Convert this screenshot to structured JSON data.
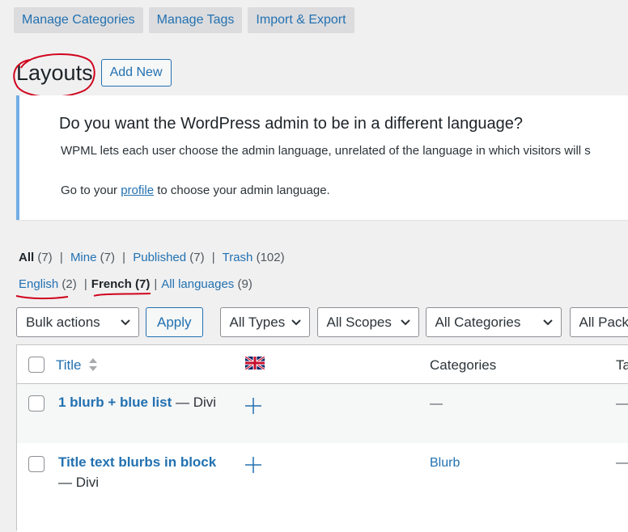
{
  "top_tabs": [
    "Manage Categories",
    "Manage Tags",
    "Import & Export"
  ],
  "page_title": "Layouts",
  "add_new": "Add New",
  "notice": {
    "heading": "Do you want the WordPress admin to be in a different language?",
    "line1": "WPML lets each user choose the admin language, unrelated of the language in which visitors will s",
    "line2_pre": "Go to your ",
    "line2_link": "profile",
    "line2_post": " to choose your admin language."
  },
  "status_filters": [
    {
      "label": "All",
      "count": "(7)"
    },
    {
      "label": "Mine",
      "count": "(7)"
    },
    {
      "label": "Published",
      "count": "(7)"
    },
    {
      "label": "Trash",
      "count": "(102)"
    }
  ],
  "language_filters": [
    {
      "label": "English",
      "count": "(2)"
    },
    {
      "label": "French",
      "count": "(7)"
    },
    {
      "label": "All languages",
      "count": "(9)"
    }
  ],
  "bulk_actions": "Bulk actions",
  "apply": "Apply",
  "filters": [
    "All Types",
    "All Scopes",
    "All Categories",
    "All Packs"
  ],
  "table": {
    "headers": {
      "title": "Title",
      "categories": "Categories",
      "tags": "Ta"
    },
    "rows": [
      {
        "title": "1 blurb + blue list",
        "suffix": " — Divi",
        "category": "—",
        "tag": "—"
      },
      {
        "title": "Title text blurbs in block",
        "suffix": "— Divi",
        "category": "Blurb",
        "tag": "—"
      }
    ]
  },
  "colors": {
    "link": "#2271b1",
    "annotation": "#d0021b",
    "notice_border": "#72aee6"
  }
}
